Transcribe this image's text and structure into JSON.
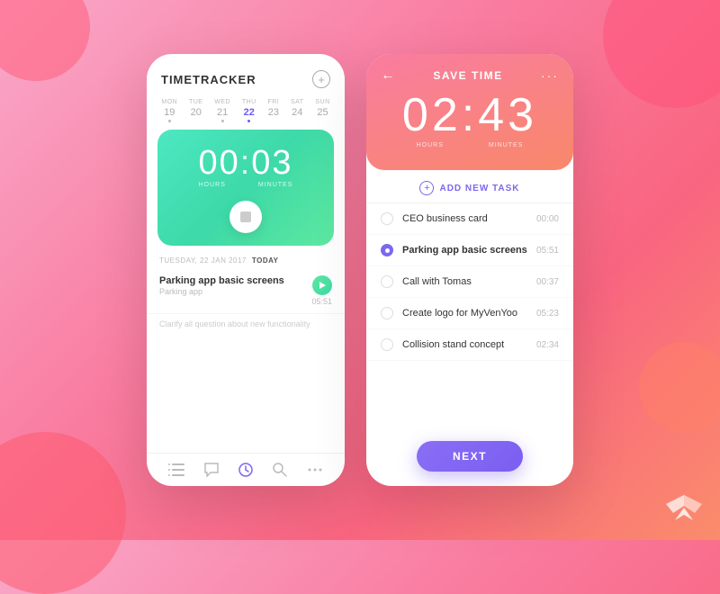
{
  "background": {
    "colors": [
      "#f9a8c9",
      "#f97ca0",
      "#f96580",
      "#fa8c6b"
    ]
  },
  "left_card": {
    "title": "TIMETRACKER",
    "add_button": "+",
    "calendar": {
      "days": [
        {
          "name": "MON",
          "num": "19",
          "active": false,
          "dot": true
        },
        {
          "name": "TUE",
          "num": "20",
          "active": false,
          "dot": false
        },
        {
          "name": "WED",
          "num": "21",
          "active": false,
          "dot": true
        },
        {
          "name": "THU",
          "num": "22",
          "active": true,
          "dot": true
        },
        {
          "name": "FRI",
          "num": "23",
          "active": false,
          "dot": false
        },
        {
          "name": "SAT",
          "num": "24",
          "active": false,
          "dot": false
        },
        {
          "name": "SUN",
          "num": "25",
          "active": false,
          "dot": false
        }
      ]
    },
    "timer": {
      "hours": "00",
      "colon": ":",
      "minutes": "03",
      "hours_label": "HOURS",
      "minutes_label": "MINUTES"
    },
    "date_label": "TUESDAY, 22 JAN 2017",
    "today_label": "TODAY",
    "task": {
      "name": "Parking app basic screens",
      "sub": "Parking app",
      "time": "05:51"
    },
    "note": "Clarify all question about new functionality",
    "nav_icons": [
      "list-icon",
      "chat-icon",
      "clock-icon",
      "search-icon",
      "dots-icon"
    ]
  },
  "right_card": {
    "title": "SAVE TIME",
    "back_arrow": "←",
    "dots_menu": "···",
    "timer": {
      "hours": "02",
      "colon": ":",
      "minutes": "43",
      "hours_label": "HOURS",
      "minutes_label": "MINUTES"
    },
    "add_task_label": "ADD NEW TASK",
    "tasks": [
      {
        "name": "CEO business card",
        "time": "00:00",
        "selected": false
      },
      {
        "name": "Parking app basic screens",
        "time": "05:51",
        "selected": true
      },
      {
        "name": "Call with Tomas",
        "time": "00:37",
        "selected": false
      },
      {
        "name": "Create logo for MyVenYoo",
        "time": "05:23",
        "selected": false
      },
      {
        "name": "Collision stand concept",
        "time": "02:34",
        "selected": false
      }
    ],
    "next_button": "NEXT"
  }
}
